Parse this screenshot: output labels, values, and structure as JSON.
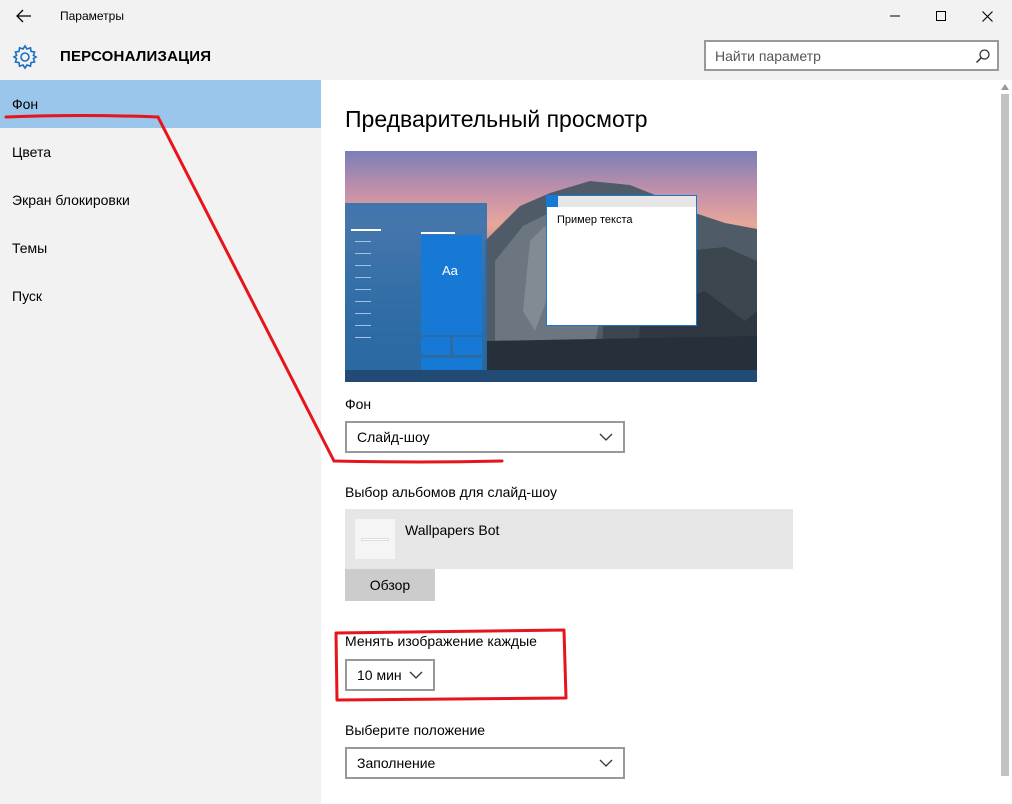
{
  "window": {
    "title": "Параметры",
    "back_icon": "arrow-left-icon",
    "minimize_icon": "minimize-icon",
    "maximize_icon": "maximize-icon",
    "close_icon": "close-icon"
  },
  "header": {
    "icon": "gear-icon",
    "title": "ПЕРСОНАЛИЗАЦИЯ",
    "search_placeholder": "Найти параметр",
    "search_icon": "search-icon"
  },
  "sidebar": {
    "items": [
      {
        "label": "Фон",
        "active": true
      },
      {
        "label": "Цвета",
        "active": false
      },
      {
        "label": "Экран блокировки",
        "active": false
      },
      {
        "label": "Темы",
        "active": false
      },
      {
        "label": "Пуск",
        "active": false
      }
    ]
  },
  "main": {
    "preview_heading": "Предварительный просмотр",
    "preview": {
      "tile_label": "Aa",
      "window_text": "Пример текста"
    },
    "background": {
      "label": "Фон",
      "value": "Слайд-шоу"
    },
    "albums": {
      "label": "Выбор альбомов для слайд-шоу",
      "album_name": "Wallpapers Bot",
      "browse_label": "Обзор"
    },
    "interval": {
      "label": "Менять изображение каждые",
      "value": "10 мин"
    },
    "position": {
      "label": "Выберите положение",
      "value": "Заполнение"
    }
  },
  "colors": {
    "accent": "#1679d6",
    "sidebar_active": "#99c6ea",
    "chrome": "#f2f2f2",
    "annotation": "#e8141b"
  }
}
